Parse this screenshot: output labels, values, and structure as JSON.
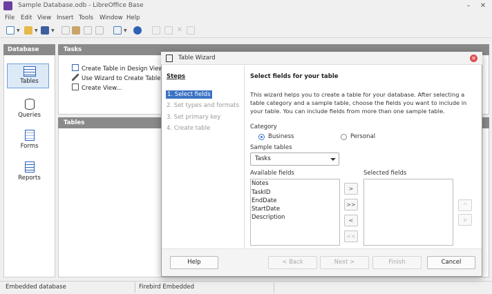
{
  "app": {
    "title": "Sample Database.odb - LibreOffice Base"
  },
  "menu": [
    "File",
    "Edit",
    "View",
    "Insert",
    "Tools",
    "Window",
    "Help"
  ],
  "window_controls": {
    "minimize": "–",
    "close": "✕"
  },
  "database_panel": {
    "header": "Database",
    "items": [
      {
        "label": "Tables",
        "icon": "table-icon",
        "selected": true
      },
      {
        "label": "Queries",
        "icon": "database-icon"
      },
      {
        "label": "Forms",
        "icon": "form-icon"
      },
      {
        "label": "Reports",
        "icon": "report-icon"
      }
    ]
  },
  "tasks_panel": {
    "header": "Tasks",
    "items": [
      {
        "label": "Create Table in Design View...",
        "icon": "design-view-icon"
      },
      {
        "label": "Use Wizard to Create Table...",
        "icon": "wizard-wand-icon"
      },
      {
        "label": "Create View...",
        "icon": "create-view-icon"
      }
    ]
  },
  "tables_panel": {
    "header": "Tables"
  },
  "statusbar": {
    "left": "Embedded database",
    "right": "Firebird Embedded"
  },
  "wizard": {
    "title": "Table Wizard",
    "steps_title": "Steps",
    "steps": [
      "1. Select fields",
      "2. Set types and formats",
      "3. Set primary key",
      "4. Create table"
    ],
    "active_step": 0,
    "content_title": "Select fields for your table",
    "description": "This wizard helps you to create a table for your database. After selecting a table category and a sample table, choose the fields you want to include in your table. You can include fields from more than one sample table.",
    "category_label": "Category",
    "category_options": [
      "Business",
      "Personal"
    ],
    "category_selected": "Business",
    "sample_tables_label": "Sample tables",
    "sample_table_value": "Tasks",
    "available_fields_label": "Available fields",
    "available_fields": [
      "Notes",
      "TaskID",
      "EndDate",
      "StartDate",
      "Description"
    ],
    "selected_fields_label": "Selected fields",
    "selected_fields": [],
    "move_buttons": {
      "add": ">",
      "add_all": ">>",
      "remove": "<",
      "remove_all": "<<"
    },
    "order_buttons": {
      "up": "^",
      "down": "v"
    },
    "buttons": {
      "help": "Help",
      "back": "< Back",
      "next": "Next >",
      "finish": "Finish",
      "cancel": "Cancel"
    }
  }
}
